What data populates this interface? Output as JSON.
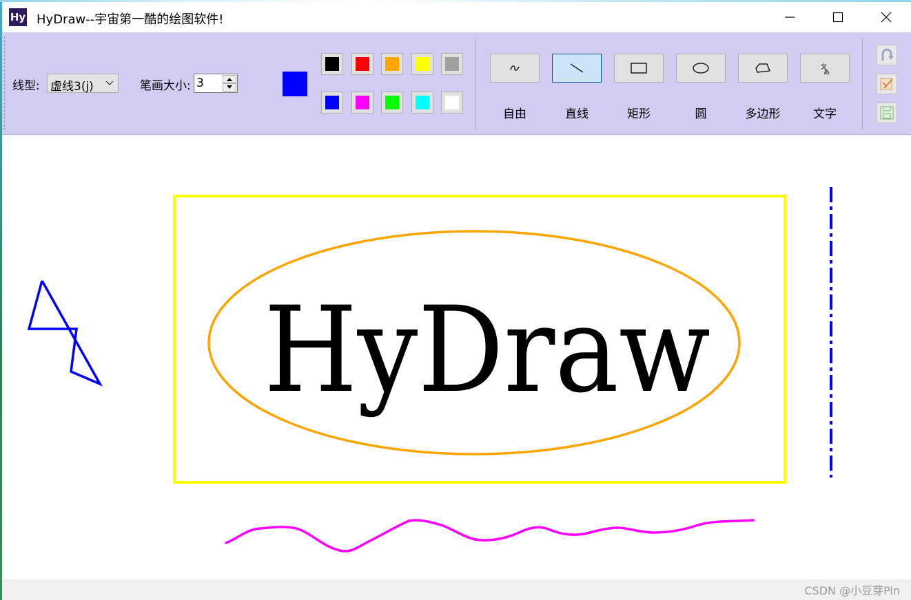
{
  "window": {
    "title": "HyDraw--宇宙第一酷的绘图软件!",
    "app_icon_text": "Hy"
  },
  "toolbar": {
    "line_type_label": "线型:",
    "line_type_value": "虚线3(j)",
    "pen_size_label": "笔画大小:",
    "pen_size_value": "3",
    "current_color": "#0000ff",
    "palette_row1": [
      "#000000",
      "#ff0000",
      "#ffa500",
      "#ffff00",
      "#a0a0a0"
    ],
    "palette_row2": [
      "#0000ff",
      "#ff00ff",
      "#00ff00",
      "#00ffff",
      "#ffffff"
    ],
    "tools": [
      {
        "label": "自由",
        "icon": "freehand-icon"
      },
      {
        "label": "直线",
        "icon": "line-icon",
        "active": true
      },
      {
        "label": "矩形",
        "icon": "rectangle-icon"
      },
      {
        "label": "圆",
        "icon": "ellipse-icon"
      },
      {
        "label": "多边形",
        "icon": "polygon-icon"
      },
      {
        "label": "文字",
        "icon": "text-icon"
      }
    ],
    "side_buttons": [
      "undo-icon",
      "clear-icon",
      "save-icon"
    ]
  },
  "canvas": {
    "text": "HyDraw",
    "rect_color": "#ffff00",
    "ellipse_color": "#ffa500",
    "polyline_color": "#0000ff",
    "wave_color": "#ff00ff",
    "dash_line_color": "#0000ff"
  },
  "statusbar": {
    "watermark": "CSDN @小豆芽Pin"
  }
}
